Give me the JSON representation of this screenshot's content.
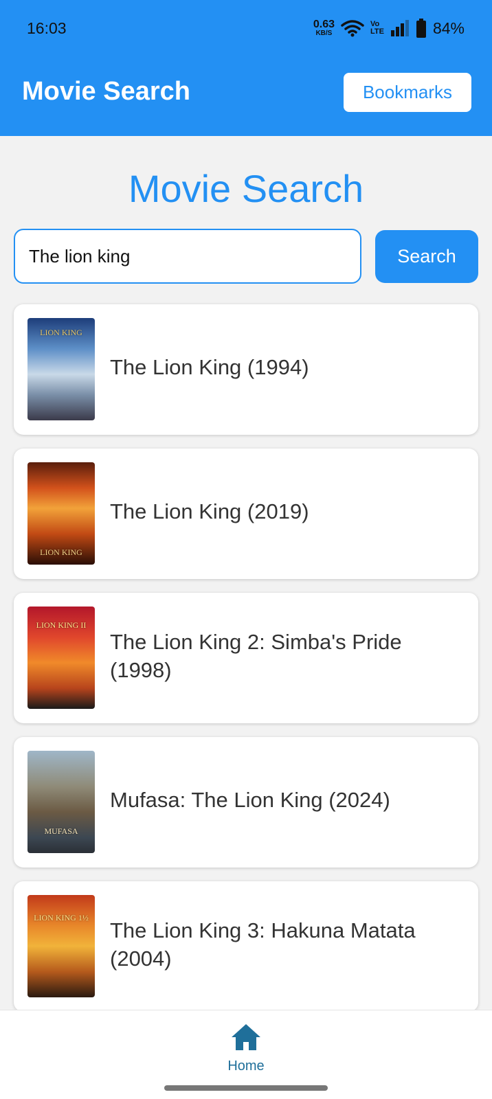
{
  "status_bar": {
    "time": "16:03",
    "net_speed_value": "0.63",
    "net_speed_unit": "KB/S",
    "volte_top": "Vo",
    "volte_bottom": "LTE",
    "battery": "84%"
  },
  "header": {
    "title": "Movie Search",
    "bookmarks_label": "Bookmarks",
    "background_color": "#2390f3"
  },
  "main": {
    "heading": "Movie Search",
    "search": {
      "value": "The lion king",
      "placeholder": "",
      "button_label": "Search"
    },
    "results": [
      {
        "title": "The Lion King (1994)",
        "poster_text": "LION KING"
      },
      {
        "title": "The Lion King (2019)",
        "poster_text": "LION KING"
      },
      {
        "title": "The Lion King 2: Simba's Pride (1998)",
        "poster_text": "LION KING II"
      },
      {
        "title": "Mufasa: The Lion King (2024)",
        "poster_text": "MUFASA"
      },
      {
        "title": "The Lion King 3: Hakuna Matata (2004)",
        "poster_text": "LION KING 1½"
      }
    ]
  },
  "bottom_nav": {
    "home_label": "Home",
    "home_icon": "home-icon"
  }
}
